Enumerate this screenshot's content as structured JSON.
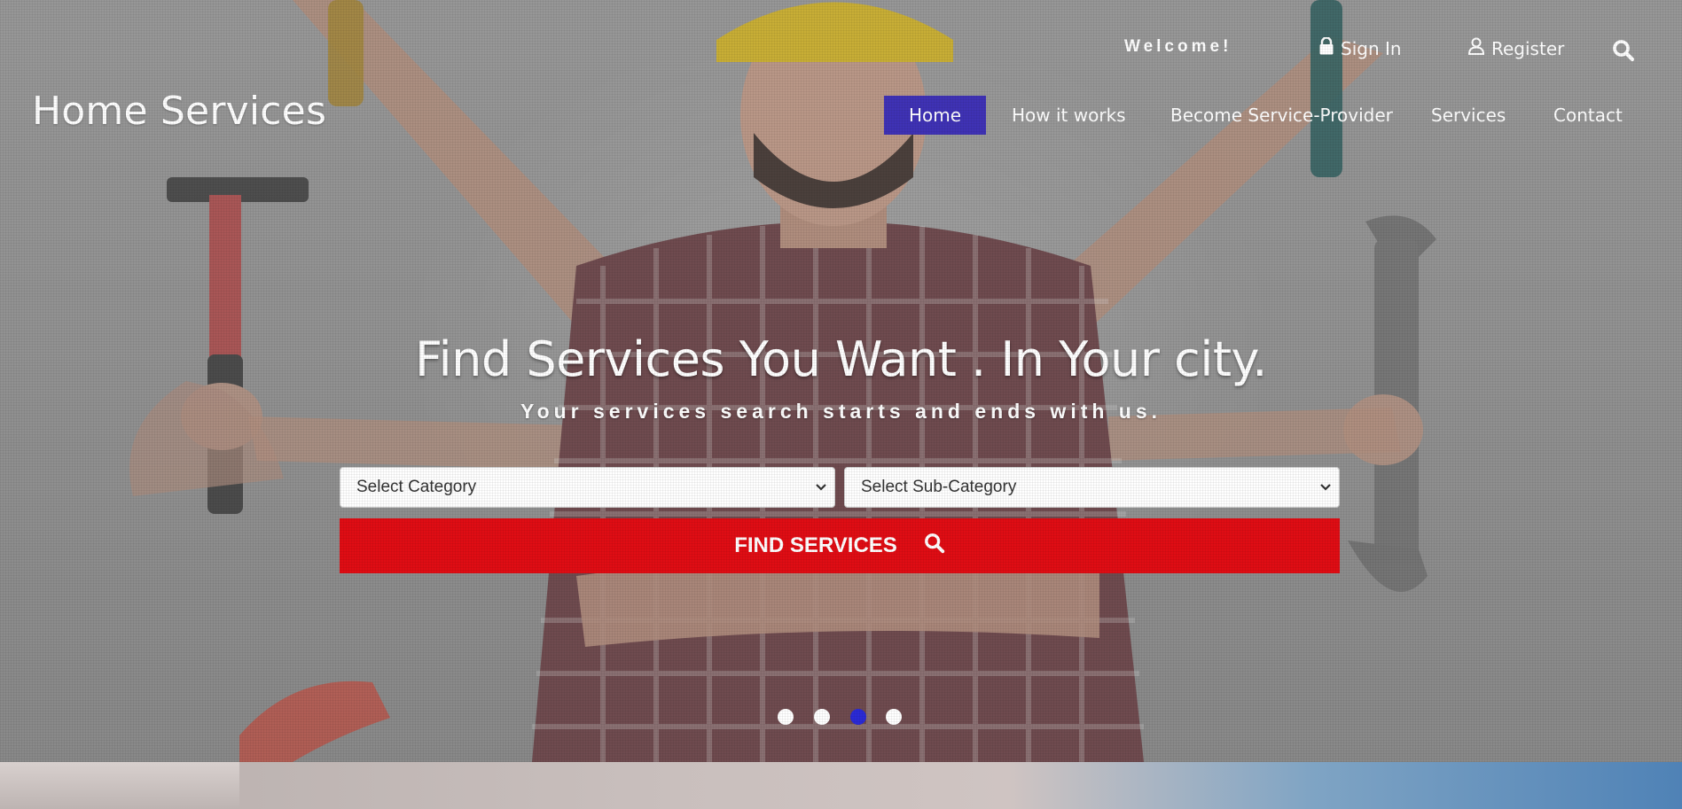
{
  "brand": {
    "name": "Home Services"
  },
  "topbar": {
    "welcome": "Welcome!",
    "sign_in": "Sign In",
    "register": "Register",
    "icons": {
      "lock": "lock-icon",
      "user": "user-icon",
      "search": "search-icon"
    }
  },
  "nav": {
    "items": [
      {
        "label": "Home",
        "active": true
      },
      {
        "label": "How it works",
        "active": false
      },
      {
        "label": "Become Service-Provider",
        "active": false
      },
      {
        "label": "Services",
        "active": false
      },
      {
        "label": "Contact",
        "active": false
      }
    ]
  },
  "hero": {
    "headline": "Find Services You Want . In Your city.",
    "subline": "Your services search starts and ends with us."
  },
  "search": {
    "category": {
      "selected": "Select Category"
    },
    "subcategory": {
      "selected": "Select Sub-Category"
    },
    "button_label": "FIND SERVICES"
  },
  "carousel": {
    "slide_count": 4,
    "active_index": 2
  },
  "colors": {
    "nav_active": "#3f32b5",
    "find_button": "#e00d14",
    "active_dot": "#2a2ad6",
    "text": "#ffffff"
  }
}
